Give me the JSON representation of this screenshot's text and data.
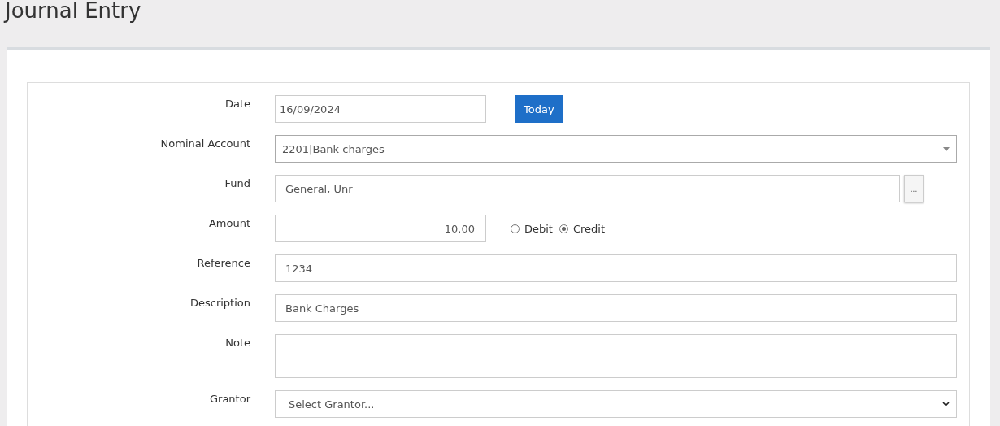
{
  "title": "Journal Entry",
  "fields": [
    {
      "kind": "date",
      "label": "Date",
      "value": "16/09/2024",
      "button": "Today"
    },
    {
      "kind": "select",
      "label": "Nominal Account",
      "value": "2201|Bank charges"
    },
    {
      "kind": "lookup",
      "label": "Fund",
      "value": "General, Unr",
      "button": "..."
    },
    {
      "kind": "amount",
      "label": "Amount",
      "value": "10.00",
      "options": [
        {
          "label": "Debit",
          "selected": false
        },
        {
          "label": "Credit",
          "selected": true
        }
      ]
    },
    {
      "kind": "text",
      "label": "Reference",
      "value": "1234"
    },
    {
      "kind": "text",
      "label": "Description",
      "value": "Bank Charges"
    },
    {
      "kind": "textarea",
      "label": "Note"
    },
    {
      "kind": "dropdown",
      "label": "Grantor",
      "value": "Select Grantor..."
    }
  ]
}
